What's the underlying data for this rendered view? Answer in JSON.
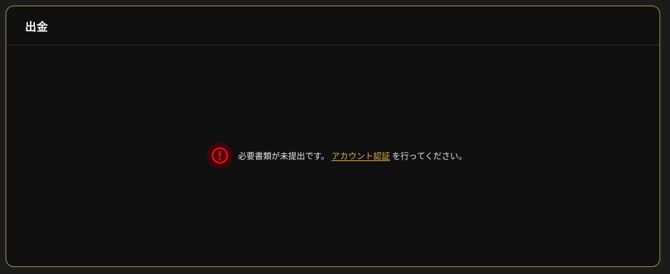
{
  "panel": {
    "title": "出金"
  },
  "notice": {
    "icon": "alert-circle-icon",
    "icon_color": "#e0101a",
    "message_before": "必要書類が未提出です。",
    "link_label": "アカウント認証",
    "message_after": "を行ってください。",
    "link_color": "#e0b341"
  },
  "colors": {
    "border": "#b8953f",
    "background": "#101010"
  }
}
